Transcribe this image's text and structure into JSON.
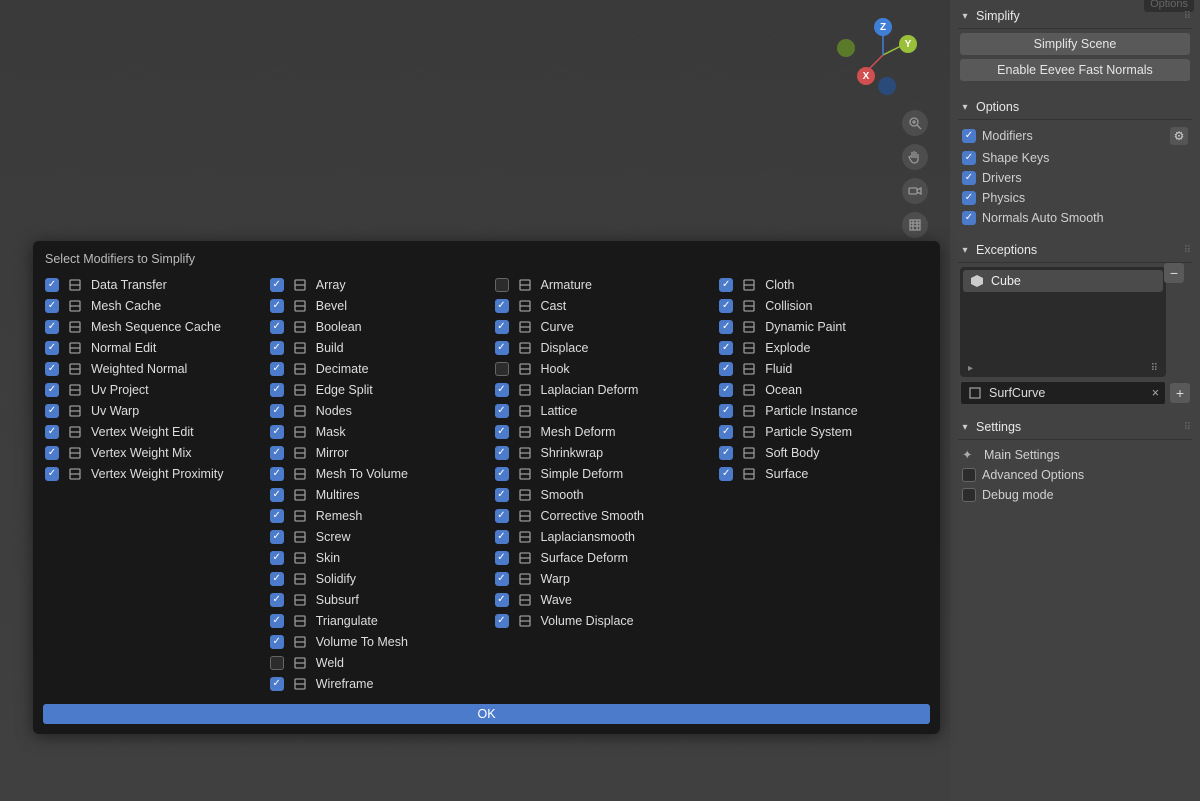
{
  "viewport": {
    "gizmo": {
      "x_label": "X",
      "y_label": "Y",
      "z_label": "Z"
    }
  },
  "sidebar": {
    "options_tab": "Options",
    "simplify": {
      "title": "Simplify",
      "btn_scene": "Simplify Scene",
      "btn_normals": "Enable Eevee Fast Normals"
    },
    "options": {
      "title": "Options",
      "modifiers": "Modifiers",
      "shape_keys": "Shape Keys",
      "drivers": "Drivers",
      "physics": "Physics",
      "normals_auto": "Normals Auto Smooth"
    },
    "exceptions": {
      "title": "Exceptions",
      "item": "Cube",
      "field_value": "SurfCurve"
    },
    "settings": {
      "title": "Settings",
      "main": "Main Settings",
      "advanced": "Advanced Options",
      "debug": "Debug mode"
    }
  },
  "popup": {
    "title": "Select Modifiers to Simplify",
    "ok_label": "OK",
    "columns": [
      [
        {
          "c": true,
          "l": "Data Transfer"
        },
        {
          "c": true,
          "l": "Mesh Cache"
        },
        {
          "c": true,
          "l": "Mesh Sequence Cache"
        },
        {
          "c": true,
          "l": "Normal Edit"
        },
        {
          "c": true,
          "l": "Weighted Normal"
        },
        {
          "c": true,
          "l": "Uv Project"
        },
        {
          "c": true,
          "l": "Uv Warp"
        },
        {
          "c": true,
          "l": "Vertex Weight Edit"
        },
        {
          "c": true,
          "l": "Vertex Weight Mix"
        },
        {
          "c": true,
          "l": "Vertex Weight Proximity"
        }
      ],
      [
        {
          "c": true,
          "l": "Array"
        },
        {
          "c": true,
          "l": "Bevel"
        },
        {
          "c": true,
          "l": "Boolean"
        },
        {
          "c": true,
          "l": "Build"
        },
        {
          "c": true,
          "l": "Decimate"
        },
        {
          "c": true,
          "l": "Edge Split"
        },
        {
          "c": true,
          "l": "Nodes"
        },
        {
          "c": true,
          "l": "Mask"
        },
        {
          "c": true,
          "l": "Mirror"
        },
        {
          "c": true,
          "l": "Mesh To Volume"
        },
        {
          "c": true,
          "l": "Multires"
        },
        {
          "c": true,
          "l": "Remesh"
        },
        {
          "c": true,
          "l": "Screw"
        },
        {
          "c": true,
          "l": "Skin"
        },
        {
          "c": true,
          "l": "Solidify"
        },
        {
          "c": true,
          "l": "Subsurf"
        },
        {
          "c": true,
          "l": "Triangulate"
        },
        {
          "c": true,
          "l": "Volume To Mesh"
        },
        {
          "c": false,
          "l": "Weld"
        },
        {
          "c": true,
          "l": "Wireframe"
        }
      ],
      [
        {
          "c": false,
          "l": "Armature"
        },
        {
          "c": true,
          "l": "Cast"
        },
        {
          "c": true,
          "l": "Curve"
        },
        {
          "c": true,
          "l": "Displace"
        },
        {
          "c": false,
          "l": "Hook"
        },
        {
          "c": true,
          "l": "Laplacian Deform"
        },
        {
          "c": true,
          "l": "Lattice"
        },
        {
          "c": true,
          "l": "Mesh Deform"
        },
        {
          "c": true,
          "l": "Shrinkwrap"
        },
        {
          "c": true,
          "l": "Simple Deform"
        },
        {
          "c": true,
          "l": "Smooth"
        },
        {
          "c": true,
          "l": "Corrective Smooth"
        },
        {
          "c": true,
          "l": "Laplaciansmooth"
        },
        {
          "c": true,
          "l": "Surface Deform"
        },
        {
          "c": true,
          "l": "Warp"
        },
        {
          "c": true,
          "l": "Wave"
        },
        {
          "c": true,
          "l": "Volume Displace"
        }
      ],
      [
        {
          "c": true,
          "l": "Cloth"
        },
        {
          "c": true,
          "l": "Collision"
        },
        {
          "c": true,
          "l": "Dynamic Paint"
        },
        {
          "c": true,
          "l": "Explode"
        },
        {
          "c": true,
          "l": "Fluid"
        },
        {
          "c": true,
          "l": "Ocean"
        },
        {
          "c": true,
          "l": "Particle Instance"
        },
        {
          "c": true,
          "l": "Particle System"
        },
        {
          "c": true,
          "l": "Soft Body"
        },
        {
          "c": true,
          "l": "Surface"
        }
      ]
    ]
  }
}
